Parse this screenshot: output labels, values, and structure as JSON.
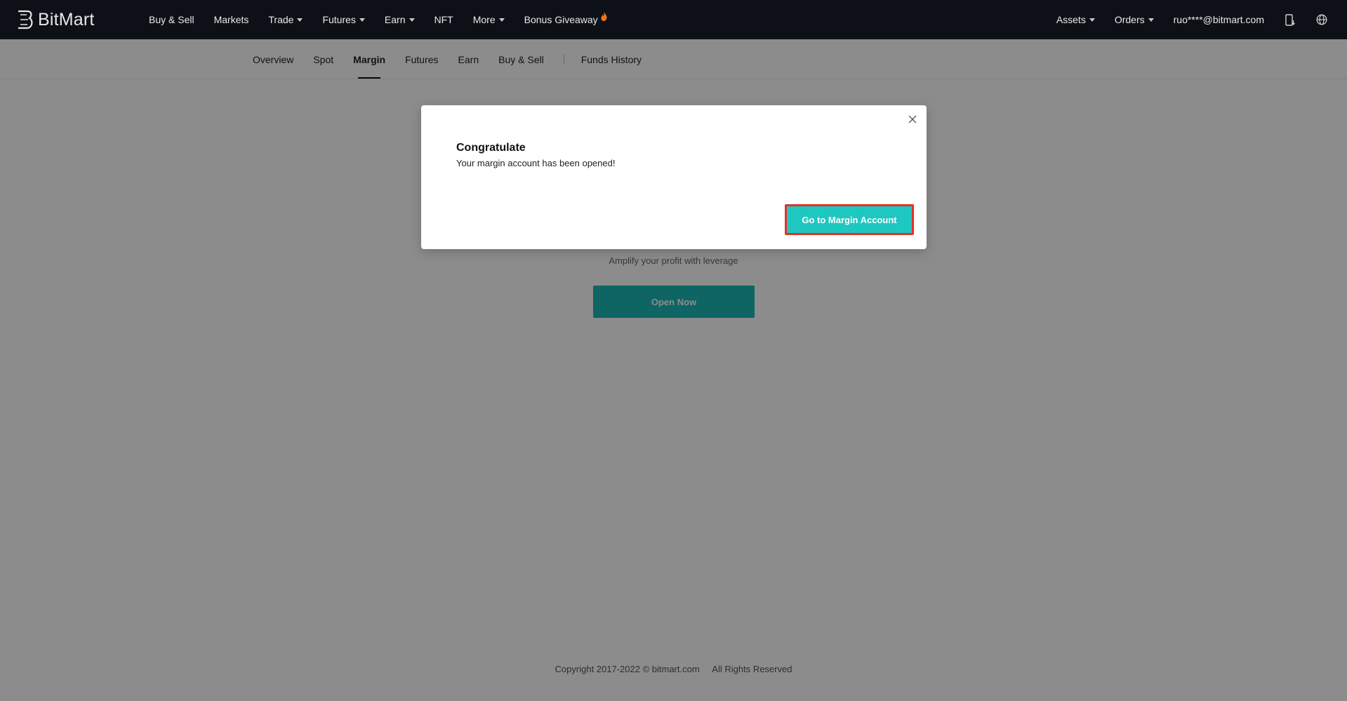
{
  "brand": {
    "name": "BitMart"
  },
  "topnav": {
    "items": [
      {
        "label": "Buy & Sell",
        "dropdown": false
      },
      {
        "label": "Markets",
        "dropdown": false
      },
      {
        "label": "Trade",
        "dropdown": true
      },
      {
        "label": "Futures",
        "dropdown": true
      },
      {
        "label": "Earn",
        "dropdown": true
      },
      {
        "label": "NFT",
        "dropdown": false
      },
      {
        "label": "More",
        "dropdown": true
      },
      {
        "label": "Bonus Giveaway",
        "dropdown": false
      }
    ],
    "right": {
      "assets": "Assets",
      "orders": "Orders",
      "user": "ruo****@bitmart.com",
      "download_icon": "mobile-download-icon",
      "language_icon": "globe-icon"
    }
  },
  "subnav": {
    "items": [
      "Overview",
      "Spot",
      "Margin",
      "Futures",
      "Earn",
      "Buy & Sell"
    ],
    "active": "Margin",
    "history": "Funds History"
  },
  "main": {
    "subtitle": "Amplify your profit with leverage",
    "open_button": "Open Now"
  },
  "footer": {
    "copyright": "Copyright 2017-2022 © bitmart.com",
    "rights": "All Rights Reserved"
  },
  "modal": {
    "title": "Congratulate",
    "message": "Your margin account has been opened!",
    "button": "Go to Margin Account",
    "close_icon": "close-icon"
  },
  "colors": {
    "nav_bg": "#0d1117",
    "accent": "#1fc7c1",
    "highlight_border": "#e5302a",
    "fire": "#e8761e"
  }
}
